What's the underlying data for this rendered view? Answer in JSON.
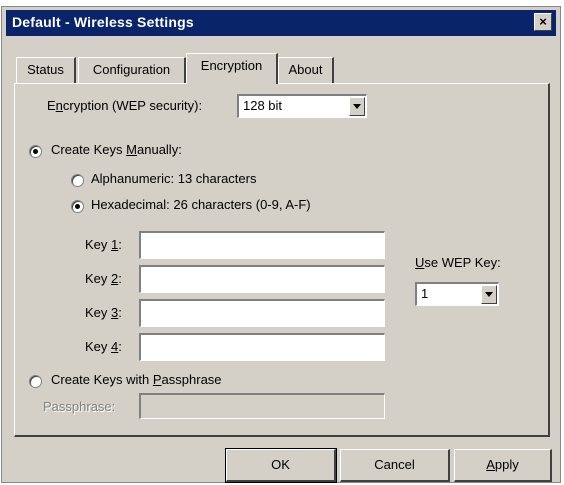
{
  "window": {
    "title": "Default - Wireless Settings",
    "close_glyph": "×"
  },
  "tabs": [
    {
      "label": "Status",
      "active": false
    },
    {
      "label": "Configuration",
      "active": false
    },
    {
      "label": "Encryption",
      "active": true
    },
    {
      "label": "About",
      "active": false
    }
  ],
  "encryption": {
    "label_pre": "E",
    "label_ul": "n",
    "label_post": "cryption (WEP security):",
    "value": "128 bit"
  },
  "manual": {
    "label_pre": "Create Keys ",
    "label_ul": "M",
    "label_post": "anually:",
    "checked": true
  },
  "alphanumeric": {
    "label": "Alphanumeric: 13 characters",
    "checked": false
  },
  "hexadecimal": {
    "label": "Hexadecimal: 26 characters (0-9, A-F)",
    "checked": true
  },
  "keys": [
    {
      "label_pre": "Key ",
      "label_ul": "1",
      "label_post": ":",
      "value": ""
    },
    {
      "label_pre": "Key ",
      "label_ul": "2",
      "label_post": ":",
      "value": ""
    },
    {
      "label_pre": "Key ",
      "label_ul": "3",
      "label_post": ":",
      "value": ""
    },
    {
      "label_pre": "Key ",
      "label_ul": "4",
      "label_post": ":",
      "value": ""
    }
  ],
  "use_wep_key": {
    "label_ul": "U",
    "label_post": "se WEP Key:",
    "value": "1"
  },
  "passphrase_option": {
    "label_pre": "Create Keys with ",
    "label_ul": "P",
    "label_post": "assphrase",
    "checked": false
  },
  "passphrase": {
    "label": "Passphrase:",
    "value": ""
  },
  "buttons": {
    "ok": "OK",
    "cancel": "Cancel",
    "apply_ul": "A",
    "apply_post": "pply"
  },
  "colors": {
    "titlebar": "#0a246a",
    "face": "#d4d0c8"
  }
}
